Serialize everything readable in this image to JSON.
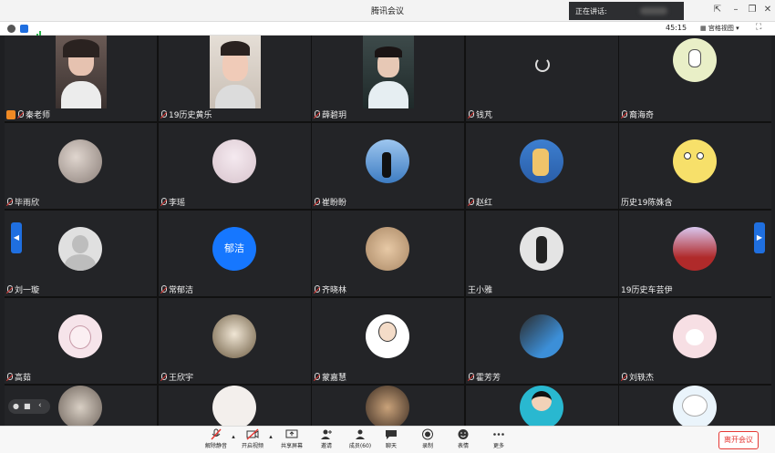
{
  "window": {
    "title": "腾讯会议"
  },
  "speaking": {
    "label": "正在讲话:"
  },
  "toolbar": {
    "timer": "45:15",
    "view_label": "宫格视图"
  },
  "tiles": [
    {
      "name": "秦老师"
    },
    {
      "name": "19历史黄乐"
    },
    {
      "name": "薛碧玥"
    },
    {
      "name": "钱芃"
    },
    {
      "name": "裔海奇"
    },
    {
      "name": "毕雨欣"
    },
    {
      "name": "李瑶"
    },
    {
      "name": "崔盼盼"
    },
    {
      "name": "赵红"
    },
    {
      "name": "历史19陈姝含"
    },
    {
      "name": "刘一璇"
    },
    {
      "name": "常郁洁",
      "avatar_text": "郁洁"
    },
    {
      "name": "齐晓林"
    },
    {
      "name": "王小雅"
    },
    {
      "name": "19历史车芸伊"
    },
    {
      "name": "高茹"
    },
    {
      "name": "王欣宇"
    },
    {
      "name": "蒙嘉慧"
    },
    {
      "name": "霍芳芳"
    },
    {
      "name": "刘轶杰"
    },
    {
      "name": ""
    },
    {
      "name": ""
    },
    {
      "name": ""
    },
    {
      "name": ""
    },
    {
      "name": ""
    }
  ],
  "bottombar": {
    "mute": "解除静音",
    "video": "开启视频",
    "share": "共享屏幕",
    "invite": "邀请",
    "members": "成员(60)",
    "chat": "聊天",
    "record": "录制",
    "reactions": "表情",
    "more": "更多",
    "leave": "离开会议"
  },
  "colors": {
    "accent": "#1f6fe0",
    "leave": "#e53935",
    "host": "#f08a24"
  }
}
